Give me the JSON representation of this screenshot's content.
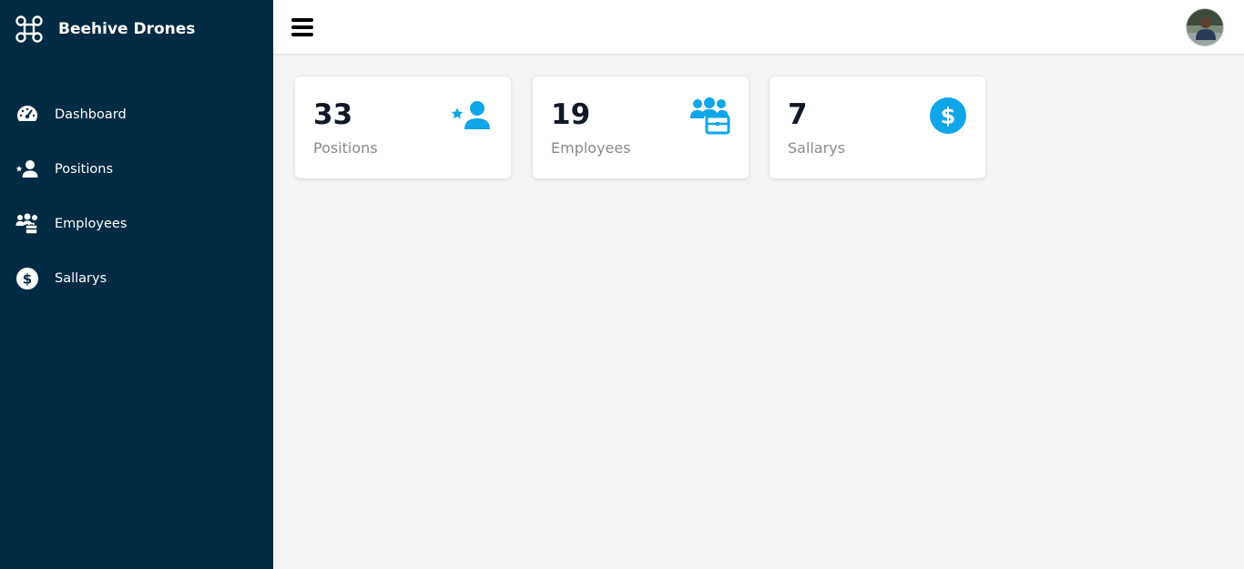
{
  "brand": {
    "name": "Beehive Drones",
    "icon": "drone-icon"
  },
  "sidebar": {
    "items": [
      {
        "label": "Dashboard",
        "icon": "gauge-icon"
      },
      {
        "label": "Positions",
        "icon": "user-star-icon"
      },
      {
        "label": "Employees",
        "icon": "users-briefcase-icon"
      },
      {
        "label": "Sallarys",
        "icon": "dollar-circle-icon"
      }
    ]
  },
  "topbar": {
    "menu_icon": "hamburger-menu-icon",
    "avatar": "user-avatar"
  },
  "cards": [
    {
      "value": "33",
      "label": "Positions",
      "icon": "user-star-icon"
    },
    {
      "value": "19",
      "label": "Employees",
      "icon": "users-briefcase-icon"
    },
    {
      "value": "7",
      "label": "Sallarys",
      "icon": "dollar-circle-icon"
    }
  ],
  "colors": {
    "sidebar_bg": "#012b44",
    "accent": "#0ea5e9",
    "page_bg": "#f4f4f4",
    "card_value": "#111827",
    "card_label": "#8a8a8a"
  }
}
